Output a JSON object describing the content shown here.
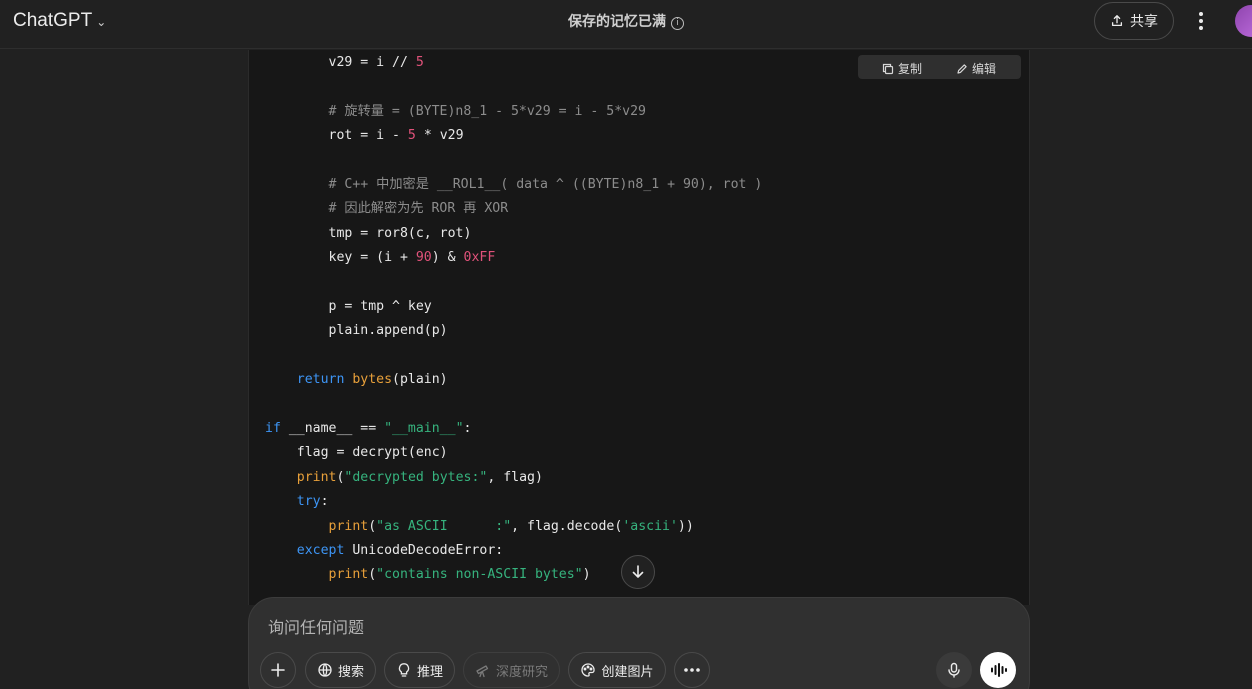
{
  "header": {
    "model_name": "ChatGPT",
    "memory_notice": "保存的记忆已满",
    "share_label": "共享"
  },
  "code_toolbar": {
    "copy_label": "复制",
    "edit_label": "编辑"
  },
  "code": {
    "lines": [
      [
        [
          "pl",
          "        v29 = i // "
        ],
        [
          "num",
          "5"
        ]
      ],
      [],
      [
        [
          "cm",
          "        # 旋转量 = (BYTE)n8_1 - 5*v29 = i - 5*v29"
        ]
      ],
      [
        [
          "pl",
          "        rot = i - "
        ],
        [
          "num",
          "5"
        ],
        [
          "pl",
          " * v29"
        ]
      ],
      [],
      [
        [
          "cm",
          "        # C++ 中加密是 __ROL1__( data ^ ((BYTE)n8_1 + 90), rot )"
        ]
      ],
      [
        [
          "cm",
          "        # 因此解密为先 ROR 再 XOR"
        ]
      ],
      [
        [
          "pl",
          "        tmp = ror8(c, rot)"
        ]
      ],
      [
        [
          "pl",
          "        key = (i + "
        ],
        [
          "num",
          "90"
        ],
        [
          "pl",
          ") & "
        ],
        [
          "num",
          "0xFF"
        ]
      ],
      [],
      [
        [
          "pl",
          "        p = tmp ^ key"
        ]
      ],
      [
        [
          "pl",
          "        plain.append(p)"
        ]
      ],
      [],
      [
        [
          "kw",
          "    return "
        ],
        [
          "fn",
          "bytes"
        ],
        [
          "pl",
          "(plain)"
        ]
      ],
      [],
      [
        [
          "kw",
          "if "
        ],
        [
          "pl",
          "__name__ == "
        ],
        [
          "str",
          "\"__main__\""
        ],
        [
          "pl",
          ":"
        ]
      ],
      [
        [
          "pl",
          "    flag = decrypt(enc)"
        ]
      ],
      [
        [
          "fn",
          "    print"
        ],
        [
          "pl",
          "("
        ],
        [
          "str",
          "\"decrypted bytes:\""
        ],
        [
          "pl",
          ", flag)"
        ]
      ],
      [
        [
          "kw",
          "    try"
        ],
        [
          "pl",
          ":"
        ]
      ],
      [
        [
          "fn",
          "        print"
        ],
        [
          "pl",
          "("
        ],
        [
          "str",
          "\"as ASCII      :\""
        ],
        [
          "pl",
          ", flag.decode("
        ],
        [
          "str",
          "'ascii'"
        ],
        [
          "pl",
          "))"
        ]
      ],
      [
        [
          "kw",
          "    except "
        ],
        [
          "pl",
          "UnicodeDecodeError:"
        ]
      ],
      [
        [
          "fn",
          "        print"
        ],
        [
          "pl",
          "("
        ],
        [
          "str",
          "\"contains non-ASCII bytes\""
        ],
        [
          "pl",
          ")"
        ]
      ]
    ]
  },
  "composer": {
    "placeholder": "询问任何问题",
    "search_label": "搜索",
    "reason_label": "推理",
    "deep_research_label": "深度研究",
    "create_image_label": "创建图片"
  },
  "icons": {
    "model_chevron": "chevron-down-icon",
    "info": "info-icon",
    "share": "share-upload-icon",
    "menu": "more-vertical-icon",
    "copy": "copy-icon",
    "edit": "pencil-icon",
    "scroll": "arrow-down-icon",
    "plus": "plus-icon",
    "search": "globe-icon",
    "reason": "lightbulb-icon",
    "deep_research": "telescope-icon",
    "create_image": "palette-icon",
    "more": "more-horizontal-icon",
    "mic": "microphone-icon",
    "voice": "voice-wave-icon"
  }
}
